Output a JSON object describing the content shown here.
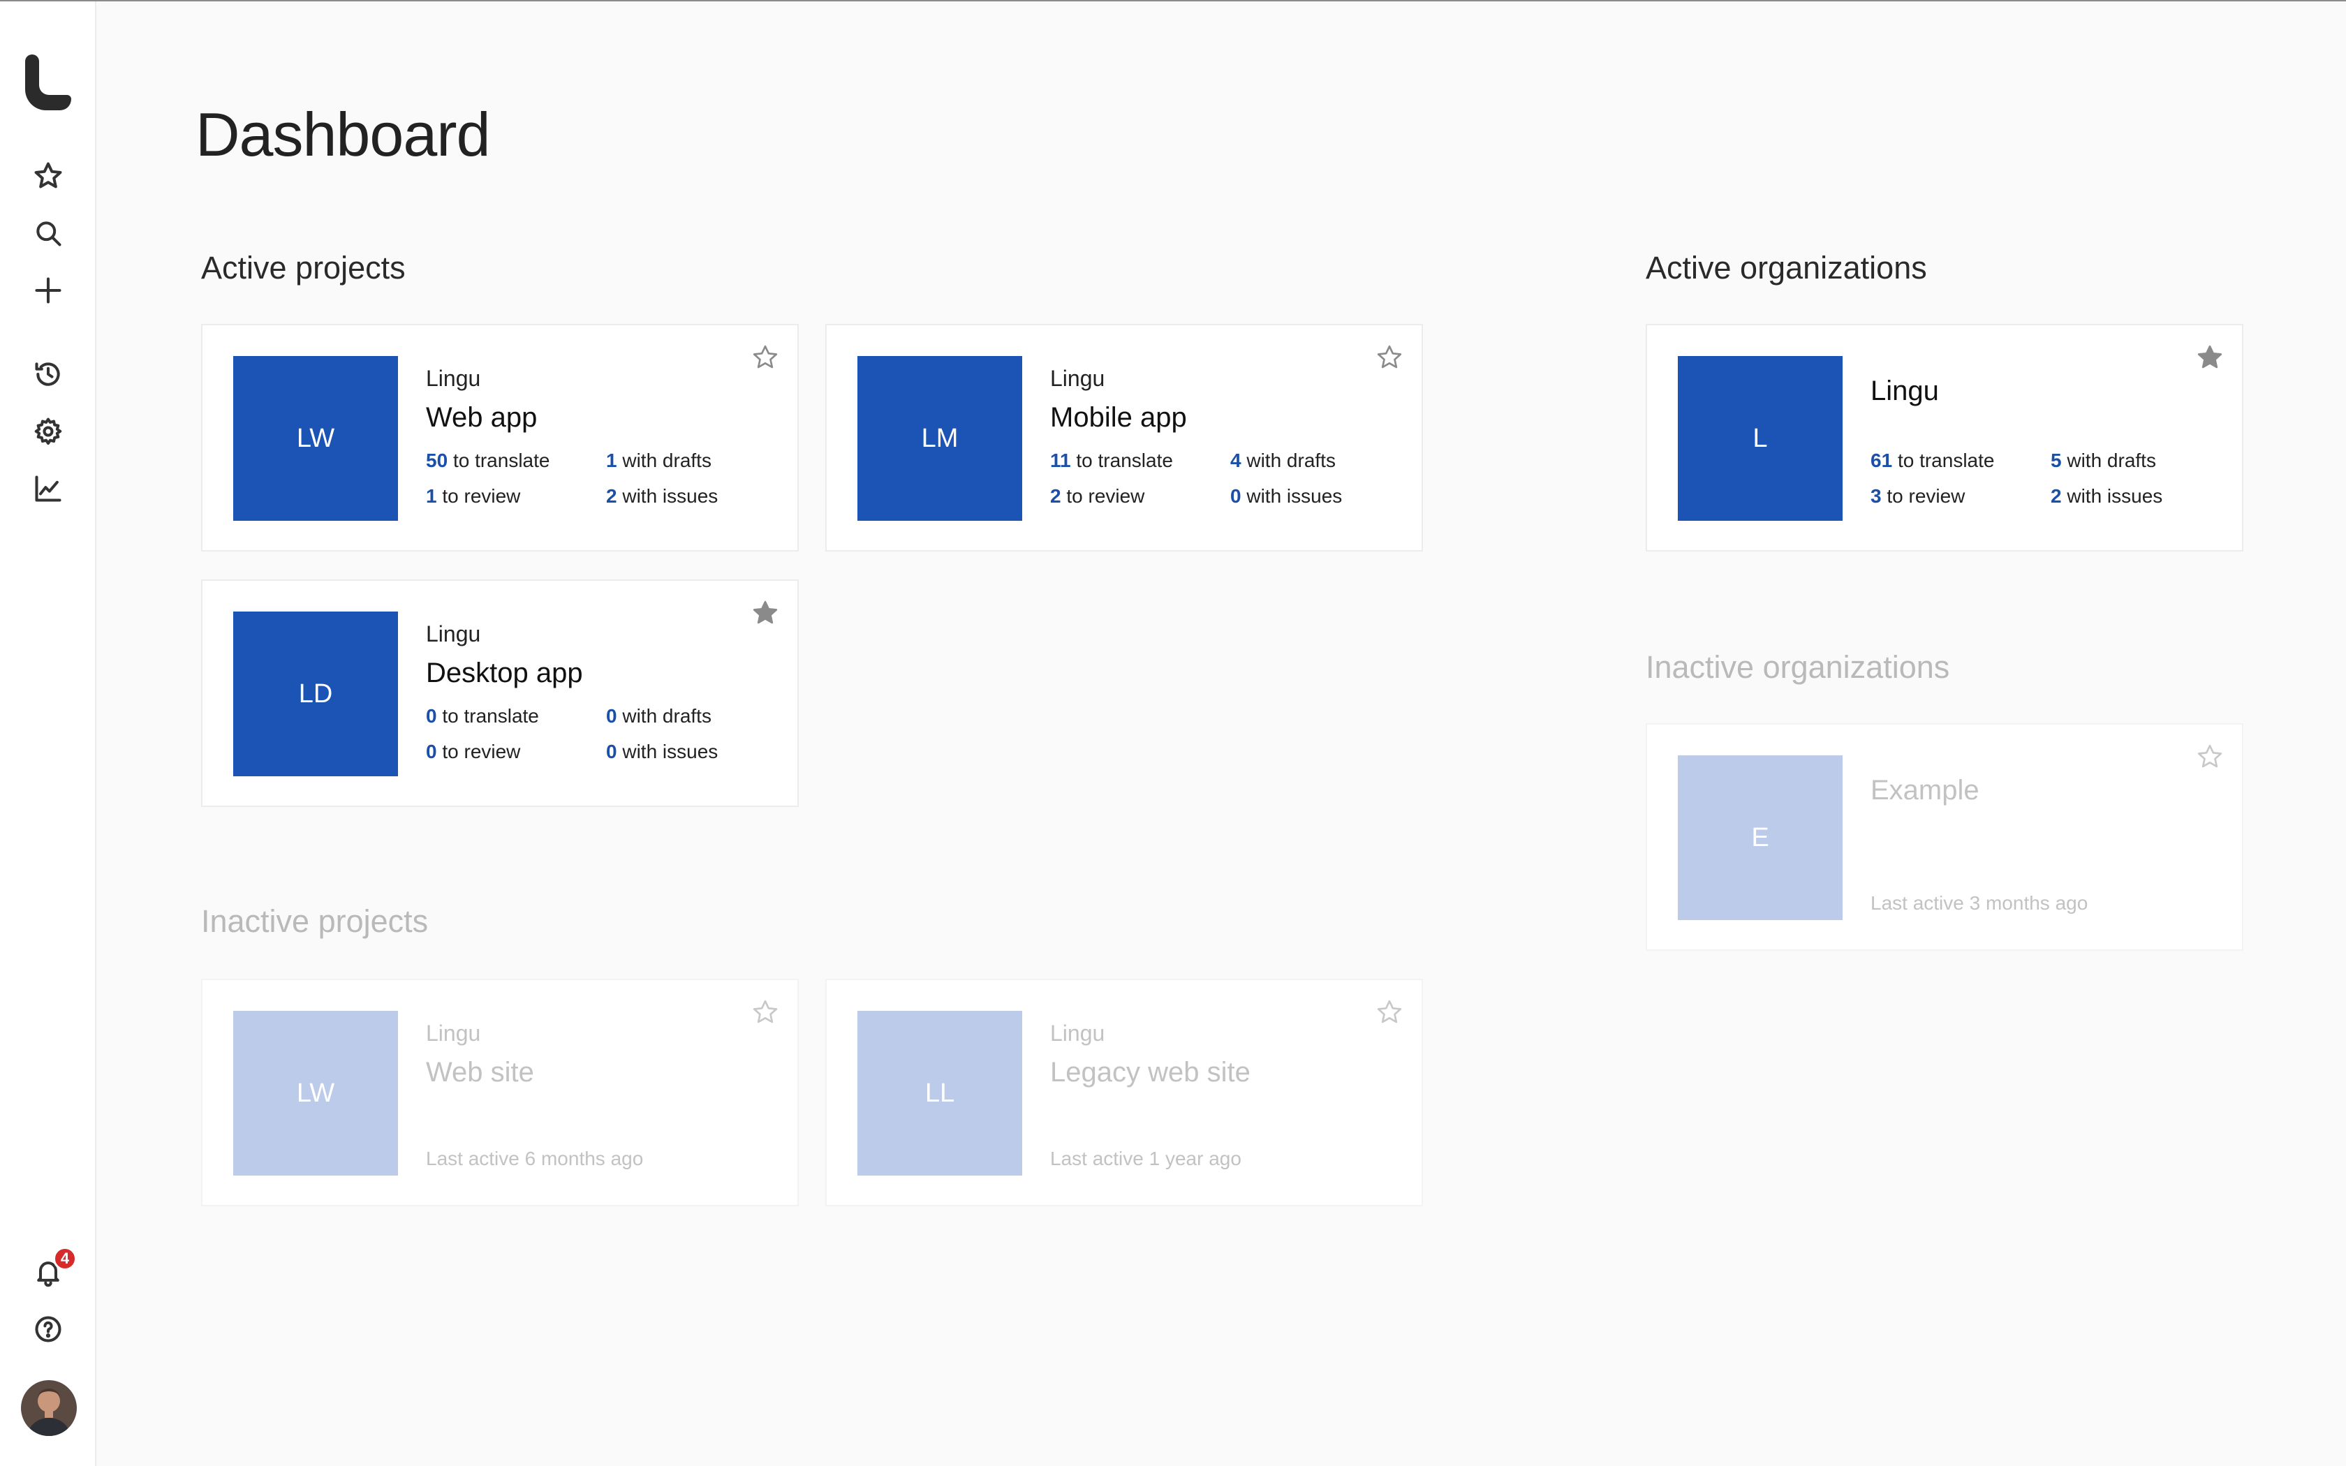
{
  "page": {
    "title": "Dashboard"
  },
  "sidebar": {
    "notifications_count": "4"
  },
  "sections": {
    "active_projects": "Active projects",
    "inactive_projects": "Inactive projects",
    "active_orgs": "Active organizations",
    "inactive_orgs": "Inactive organizations"
  },
  "active_projects": [
    {
      "initials": "LW",
      "org": "Lingu",
      "name": "Web app",
      "starred": false,
      "translate": "50",
      "translate_label": "to translate",
      "review": "1",
      "review_label": "to review",
      "drafts": "1",
      "drafts_label": "with drafts",
      "issues": "2",
      "issues_label": "with issues"
    },
    {
      "initials": "LM",
      "org": "Lingu",
      "name": "Mobile app",
      "starred": false,
      "translate": "11",
      "translate_label": "to translate",
      "review": "2",
      "review_label": "to review",
      "drafts": "4",
      "drafts_label": "with drafts",
      "issues": "0",
      "issues_label": "with issues"
    },
    {
      "initials": "LD",
      "org": "Lingu",
      "name": "Desktop app",
      "starred": true,
      "translate": "0",
      "translate_label": "to translate",
      "review": "0",
      "review_label": "to review",
      "drafts": "0",
      "drafts_label": "with drafts",
      "issues": "0",
      "issues_label": "with issues"
    }
  ],
  "inactive_projects": [
    {
      "initials": "LW",
      "org": "Lingu",
      "name": "Web site",
      "last_active": "Last active 6 months ago",
      "starred": false
    },
    {
      "initials": "LL",
      "org": "Lingu",
      "name": "Legacy web site",
      "last_active": "Last active 1 year ago",
      "starred": false
    }
  ],
  "active_orgs": [
    {
      "initials": "L",
      "name": "Lingu",
      "starred": true,
      "translate": "61",
      "translate_label": "to translate",
      "review": "3",
      "review_label": "to review",
      "drafts": "5",
      "drafts_label": "with drafts",
      "issues": "2",
      "issues_label": "with issues"
    }
  ],
  "inactive_orgs": [
    {
      "initials": "E",
      "name": "Example",
      "last_active": "Last active 3 months ago",
      "starred": false
    }
  ],
  "colors": {
    "accent": "#1b54b5",
    "accent_faded": "#bccbea",
    "badge": "#d72a2a",
    "link_number": "#1b4fa8"
  },
  "icons": [
    "logo",
    "star-icon",
    "search-icon",
    "plus-icon",
    "history-icon",
    "gear-icon",
    "chart-icon",
    "bell-icon",
    "help-icon"
  ]
}
